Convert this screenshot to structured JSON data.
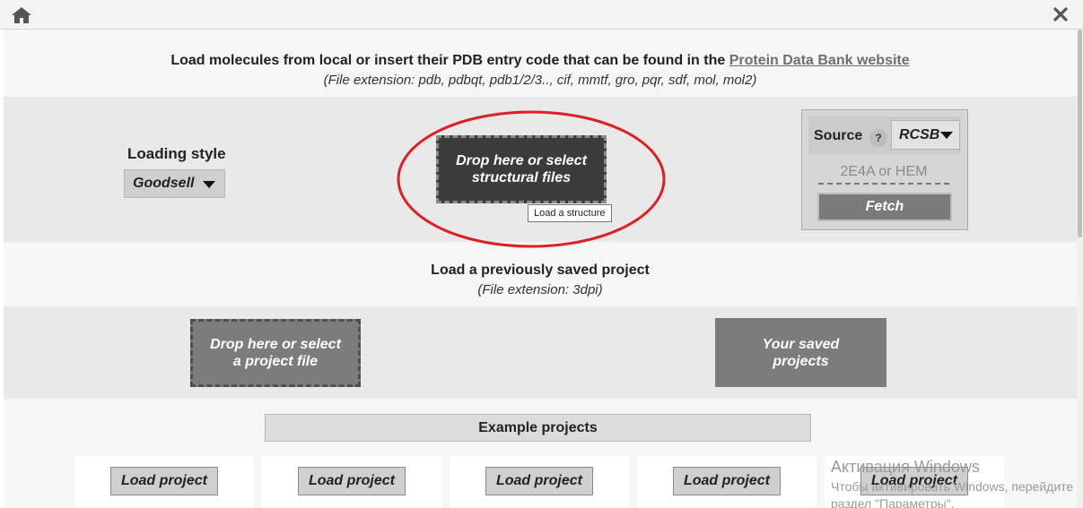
{
  "header": {
    "home_icon": "home-icon",
    "close_icon": "close-icon"
  },
  "load_molecules": {
    "title_prefix": "Load molecules from local or insert their PDB entry code that can be found in the ",
    "link_text": "Protein Data Bank website",
    "subtitle": "(File extension: pdb, pdbqt, pdb1/2/3.., cif, mmtf, gro, pqr, sdf, mol, mol2)",
    "loading_style_label": "Loading style",
    "loading_style_value": "Goodsell",
    "drop_label_line1": "Drop here or select",
    "drop_label_line2": "structural files",
    "tooltip": "Load a structure"
  },
  "source": {
    "label": "Source",
    "help": "?",
    "selected": "RCSB",
    "input_placeholder": "2E4A or HEM",
    "fetch_label": "Fetch"
  },
  "load_project": {
    "title": "Load a previously saved project",
    "subtitle": "(File extension: 3dpi)",
    "drop_line1": "Drop here or select",
    "drop_line2": "a project file",
    "saved_line1": "Your saved",
    "saved_line2": "projects"
  },
  "examples": {
    "label": "Example projects",
    "cards": [
      {
        "button": "Load project"
      },
      {
        "button": "Load project"
      },
      {
        "button": "Load project"
      },
      {
        "button": "Load project"
      },
      {
        "button": "Load project"
      }
    ]
  },
  "watermark": {
    "title": "Активация Windows",
    "line1": "Чтобы активировать Windows, перейдите",
    "line2": "раздел \"Параметры\"."
  },
  "colors": {
    "annotation": "#dd1f26",
    "dark_drop": "#3b3b3b",
    "gray_button": "#7c7c7c"
  }
}
